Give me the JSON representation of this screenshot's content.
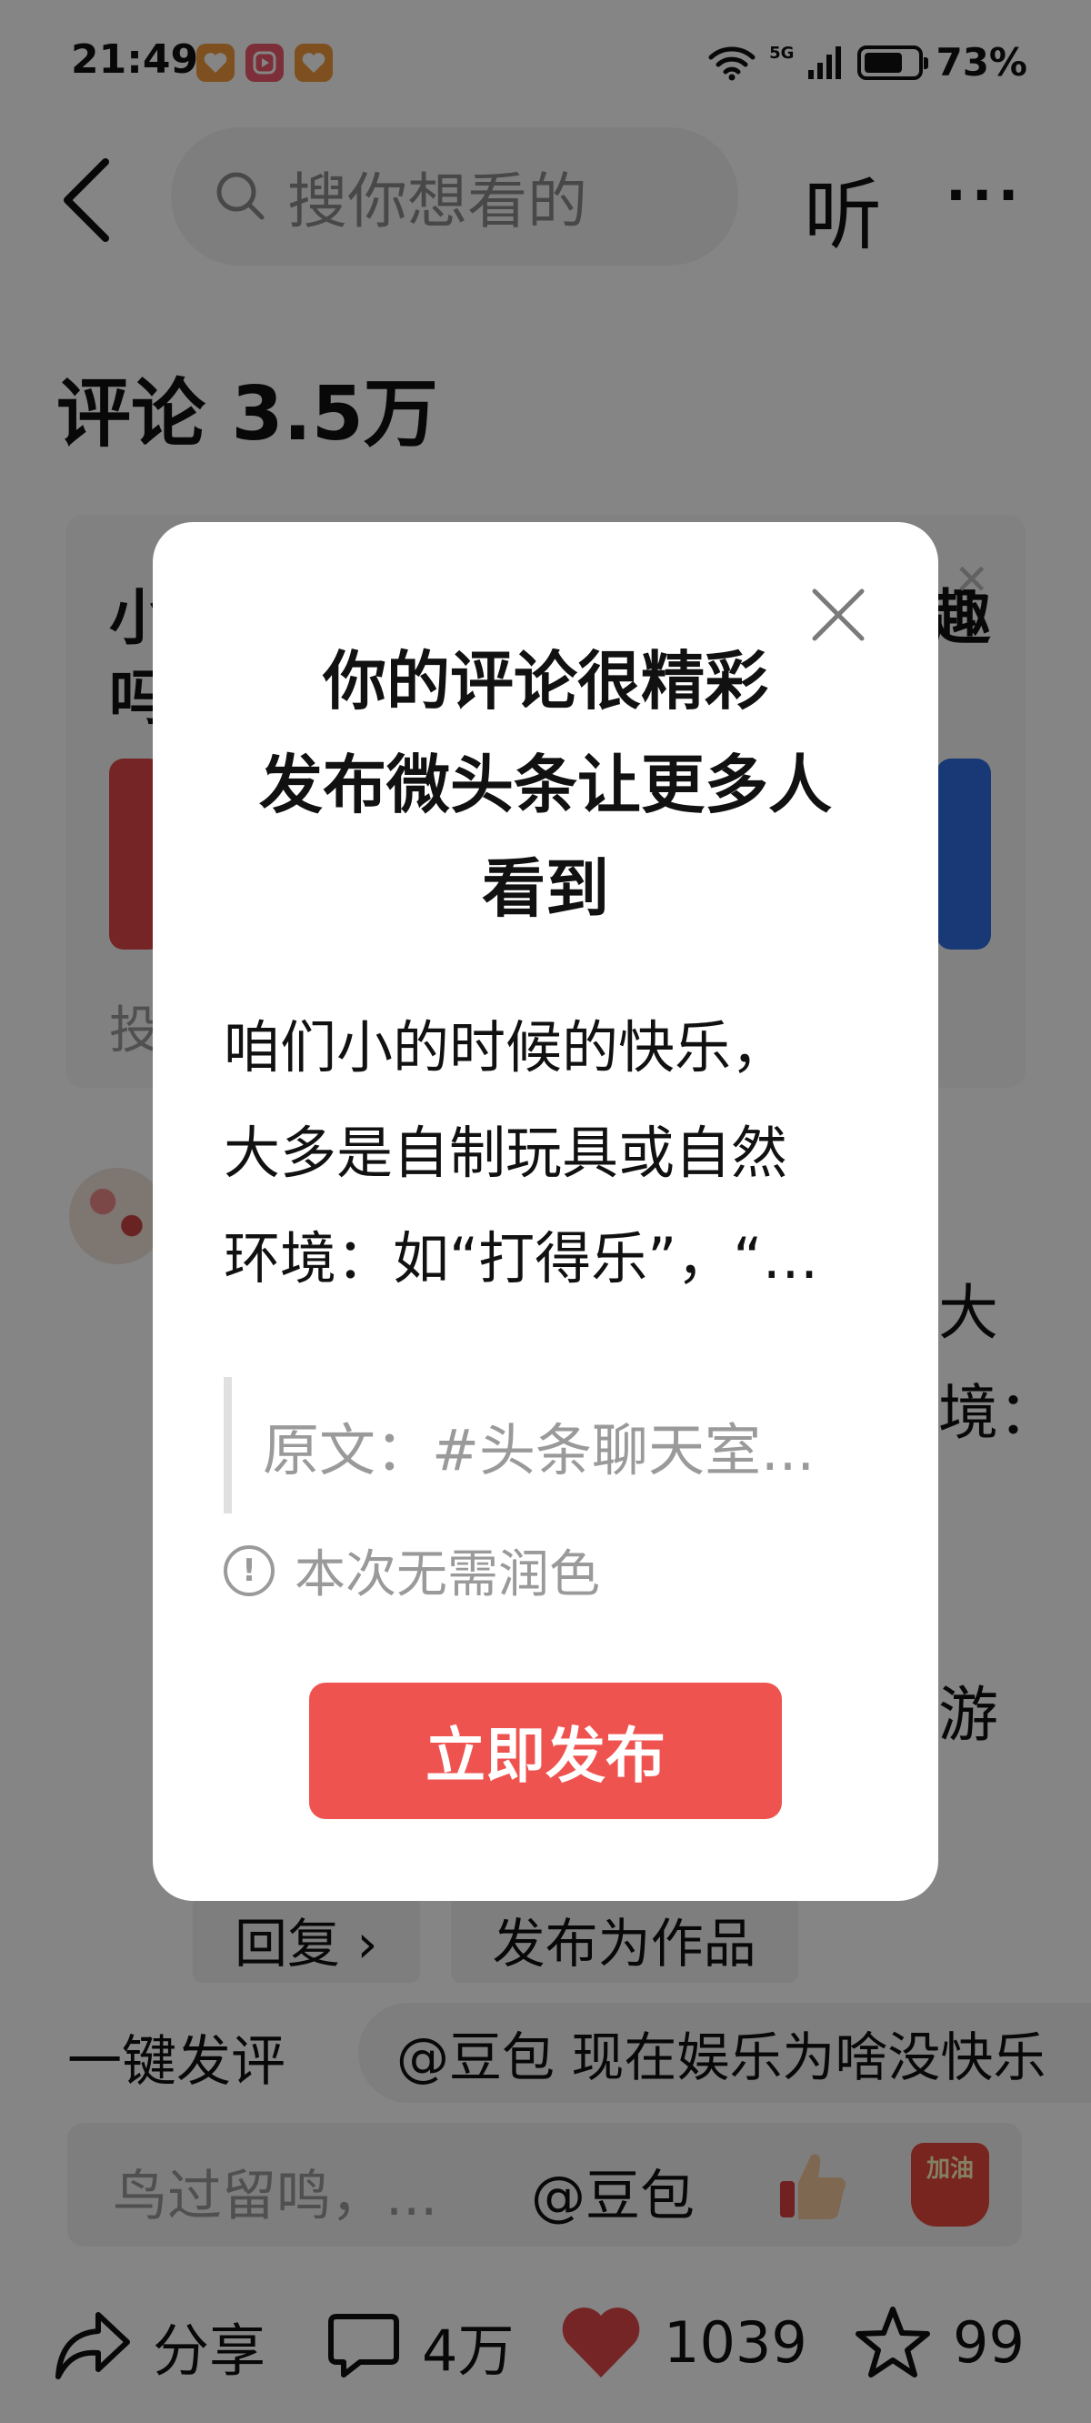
{
  "status_bar": {
    "time": "21:49",
    "network": "5G",
    "battery_percent_label": "73%",
    "battery_level": 0.73,
    "app_icons": [
      "heart-app-icon",
      "play-app-icon",
      "heart-app-icon"
    ]
  },
  "header": {
    "search_placeholder": "搜你想看的",
    "listen_label": "听",
    "more_label": "···"
  },
  "comments": {
    "title": "评论 3.5万"
  },
  "background": {
    "card_char_1": "小",
    "card_char_2": "吗",
    "card_char_right": "趣",
    "card_note_char": "投",
    "comment_frag_1": "大",
    "comment_frag_2": "境：",
    "comment_frag_3": "游",
    "reply_label": "回复 ›",
    "publish_as_work_label": "发布为作品"
  },
  "quick_comment": {
    "label": "一键发评",
    "suggestion": "@豆包 现在娱乐为啥没快乐"
  },
  "comment_input": {
    "placeholder": "鸟过留鸣，...",
    "mention": "@豆包",
    "jiayou_text": "加油"
  },
  "bottom_bar": {
    "share_label": "分享",
    "comment_count": "4万",
    "like_count": "1039",
    "favorite_count": "99"
  },
  "modal": {
    "title_line_1": "你的评论很精彩",
    "title_line_2": "发布微头条让更多人",
    "title_line_3": "看到",
    "comment_line_1": "咱们小的时候的快乐，",
    "comment_line_2": "大多是自制玩具或自然",
    "comment_line_3": "环境：如“打得乐”，“…",
    "original_label": "原文：#头条聊天室...",
    "notice": "本次无需润色",
    "publish_button": "立即发布"
  },
  "colors": {
    "publish_button": "#ef5350",
    "like_heart": "#e04848",
    "overlay": "rgba(0,0,0,0.48)"
  }
}
